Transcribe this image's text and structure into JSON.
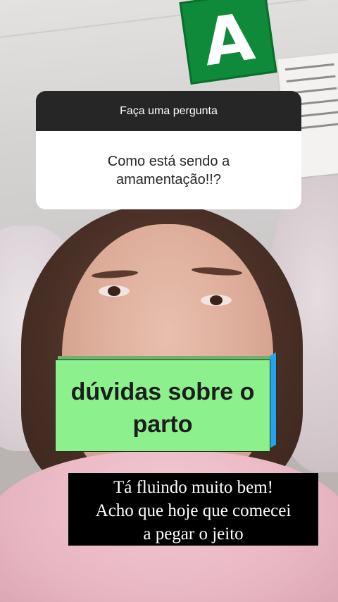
{
  "background": {
    "sign_letter": "A",
    "sign_color": "#0e8a3a"
  },
  "question_sticker": {
    "header": "Faça uma pergunta",
    "question_lines": [
      "Como está sendo a",
      "amamentação!!?"
    ]
  },
  "callout": {
    "lines": [
      "dúvidas sobre o",
      "parto"
    ],
    "color": "#8cf08c",
    "edge_color": "#22a6e8"
  },
  "caption": {
    "lines": [
      "Tá fluindo muito bem!",
      "Acho que hoje que comecei",
      "a pegar o jeito"
    ]
  }
}
